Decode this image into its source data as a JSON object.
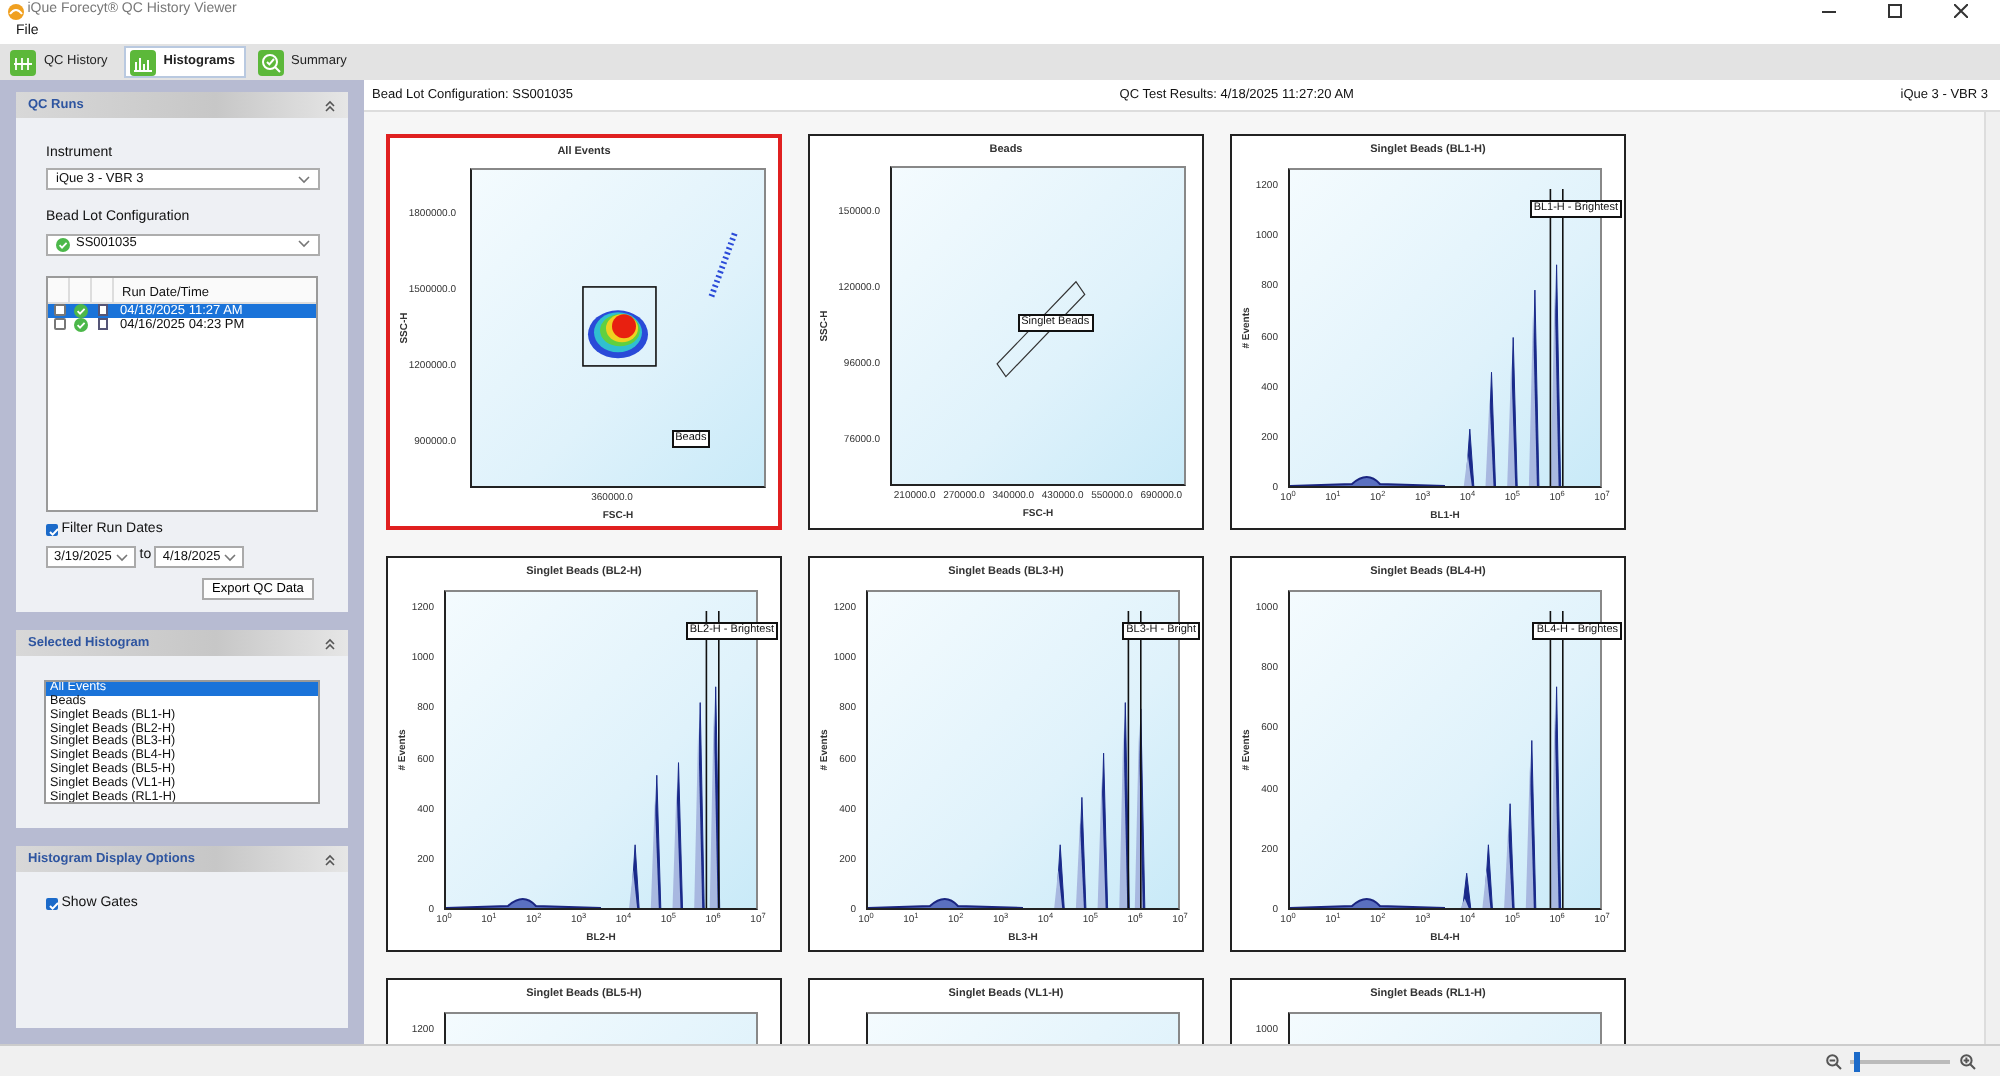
{
  "window": {
    "title": "iQue Forecyt® QC History Viewer"
  },
  "menu": [
    "File"
  ],
  "tabs": [
    {
      "label": "QC History",
      "selected": false
    },
    {
      "label": "Histograms",
      "selected": true
    },
    {
      "label": "Summary",
      "selected": false
    }
  ],
  "qc_runs": {
    "title": "QC Runs",
    "instrument_label": "Instrument",
    "instrument": "iQue 3 - VBR 3",
    "bead_lot_label": "Bead Lot Configuration",
    "bead_lot": "SS001035",
    "runs_header": "Run Date/Time",
    "runs": [
      {
        "date": "04/18/2025 11:27 AM",
        "checked": false,
        "selected": true
      },
      {
        "date": "04/16/2025 04:23 PM",
        "checked": false,
        "selected": false
      }
    ],
    "filter": {
      "label": "Filter Run Dates",
      "checked": true
    },
    "from": "3/19/2025",
    "to_label": "to",
    "to": "4/18/2025",
    "export_button": "Export QC Data"
  },
  "selected_histogram": {
    "title": "Selected Histogram",
    "items": [
      {
        "label": "All Events",
        "selected": true
      },
      {
        "label": "Beads",
        "selected": false
      },
      {
        "label": "Singlet Beads (BL1-H)",
        "selected": false
      },
      {
        "label": "Singlet Beads (BL2-H)",
        "selected": false
      },
      {
        "label": "Singlet Beads (BL3-H)",
        "selected": false
      },
      {
        "label": "Singlet Beads (BL4-H)",
        "selected": false
      },
      {
        "label": "Singlet Beads (BL5-H)",
        "selected": false
      },
      {
        "label": "Singlet Beads (VL1-H)",
        "selected": false
      },
      {
        "label": "Singlet Beads (RL1-H)",
        "selected": false
      }
    ]
  },
  "display_options": {
    "title": "Histogram Display Options",
    "show_gates": {
      "label": "Show Gates",
      "checked": true
    }
  },
  "header": {
    "bead_lot": "Bead Lot Configuration: SS001035",
    "results": "QC Test Results: 4/18/2025 11:27:20 AM",
    "instrument": "iQue 3 - VBR 3"
  },
  "plots": [
    {
      "kind": "scatter",
      "title": "All Events",
      "selected": true,
      "ylabel": "SSC-H",
      "xlabel": "FSC-H",
      "yticks": [
        "1800000.0",
        "1500000.0",
        "1200000.0",
        "900000.0"
      ],
      "xticks": [
        "360000.0"
      ],
      "gate": "Beads"
    },
    {
      "kind": "scatter",
      "title": "Beads",
      "selected": false,
      "ylabel": "SSC-H",
      "xlabel": "FSC-H",
      "yticks": [
        "150000.0",
        "120000.0",
        "96000.0",
        "76000.0"
      ],
      "xticks": [
        "210000.0",
        "270000.0",
        "340000.0",
        "430000.0",
        "550000.0",
        "690000.0"
      ],
      "gate": "Singlet Beads"
    },
    {
      "kind": "histogram",
      "title": "Singlet Beads (BL1-H)",
      "selected": false,
      "ylabel": "# Events",
      "xlabel": "BL1-H",
      "yticks": [
        "1200",
        "1000",
        "800",
        "600",
        "400",
        "200",
        "0"
      ],
      "xticks": [
        "10$^{0}$",
        "10$^{1}$",
        "10$^{2}$",
        "10$^{3}$",
        "10$^{4}$",
        "10$^{5}$",
        "10$^{6}$",
        "10$^{7}$"
      ],
      "gate": "BL1-H - Brightest"
    },
    {
      "kind": "histogram",
      "title": "Singlet Beads (BL2-H)",
      "selected": false,
      "ylabel": "# Events",
      "xlabel": "BL2-H",
      "yticks": [
        "1200",
        "1000",
        "800",
        "600",
        "400",
        "200",
        "0"
      ],
      "xticks": [
        "10$^{0}$",
        "10$^{1}$",
        "10$^{2}$",
        "10$^{3}$",
        "10$^{4}$",
        "10$^{5}$",
        "10$^{6}$",
        "10$^{7}$"
      ],
      "gate": "BL2-H - Brightest"
    },
    {
      "kind": "histogram",
      "title": "Singlet Beads (BL3-H)",
      "selected": false,
      "ylabel": "# Events",
      "xlabel": "BL3-H",
      "yticks": [
        "1200",
        "1000",
        "800",
        "600",
        "400",
        "200",
        "0"
      ],
      "xticks": [
        "10$^{0}$",
        "10$^{1}$",
        "10$^{2}$",
        "10$^{3}$",
        "10$^{4}$",
        "10$^{5}$",
        "10$^{6}$",
        "10$^{7}$"
      ],
      "gate": "BL3-H - Bright"
    },
    {
      "kind": "histogram",
      "title": "Singlet Beads (BL4-H)",
      "selected": false,
      "ylabel": "# Events",
      "xlabel": "BL4-H",
      "yticks": [
        "1000",
        "800",
        "600",
        "400",
        "200",
        "0"
      ],
      "xticks": [
        "10$^{0}$",
        "10$^{1}$",
        "10$^{2}$",
        "10$^{3}$",
        "10$^{4}$",
        "10$^{5}$",
        "10$^{6}$",
        "10$^{7}$"
      ],
      "gate": "BL4-H - Brightes"
    },
    {
      "kind": "histogram",
      "title": "Singlet Beads (BL5-H)",
      "selected": false,
      "yticks": [
        "1200"
      ]
    },
    {
      "kind": "histogram",
      "title": "Singlet Beads (VL1-H)",
      "selected": false
    },
    {
      "kind": "histogram",
      "title": "Singlet Beads (RL1-H)",
      "selected": false,
      "yticks": [
        "1000"
      ]
    }
  ],
  "zoom": {
    "level": 0.06
  }
}
